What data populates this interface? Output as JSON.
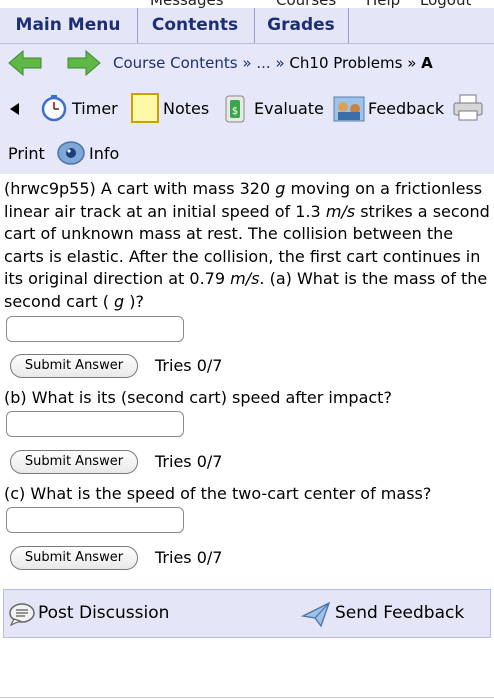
{
  "top_strip": {
    "items": [
      "Messages",
      "Courses",
      "Help",
      "Logout"
    ]
  },
  "menu": {
    "main_menu": "Main Menu",
    "contents": "Contents",
    "grades": "Grades"
  },
  "breadcrumb": {
    "course_contents": "Course Contents",
    "separator1": "»",
    "ellipsis": "...",
    "separator2": "»",
    "chapter": "Ch10 Problems",
    "separator3": "»",
    "current": "A"
  },
  "tools": {
    "timer": "Timer",
    "notes": "Notes",
    "evaluate": "Evaluate",
    "feedback": "Feedback",
    "print": "Print",
    "info": "Info"
  },
  "question": {
    "intro_1": "(hrwc9p55) A cart with mass 320 ",
    "unit_g": "g",
    "intro_2": " moving on a frictionless linear air track at an initial speed of 1.3 ",
    "unit_ms_1": "m/s",
    "intro_3": " strikes a second cart of unknown mass at rest. The collision between the carts is elastic. After the collision, the first cart continues in its original direction at 0.79 ",
    "unit_ms_2": "m/s",
    "part_a_1": ". (a) What is the mass of the second cart ( ",
    "part_a_unit": "g",
    "part_a_2": " )?",
    "part_b": "(b) What is its (second cart) speed after impact?",
    "part_c": "(c) What is the speed of the two-cart center of mass?"
  },
  "answers": [
    {
      "value": "",
      "submit_label": "Submit Answer",
      "tries": "Tries 0/7"
    },
    {
      "value": "",
      "submit_label": "Submit Answer",
      "tries": "Tries 0/7"
    },
    {
      "value": "",
      "submit_label": "Submit Answer",
      "tries": "Tries 0/7"
    }
  ],
  "footer": {
    "post_discussion": "Post Discussion",
    "send_feedback": "Send Feedback"
  },
  "colors": {
    "panel": "#e6e7f8",
    "link_blue": "#1d2f74",
    "arrow_green": "#5fb846"
  }
}
